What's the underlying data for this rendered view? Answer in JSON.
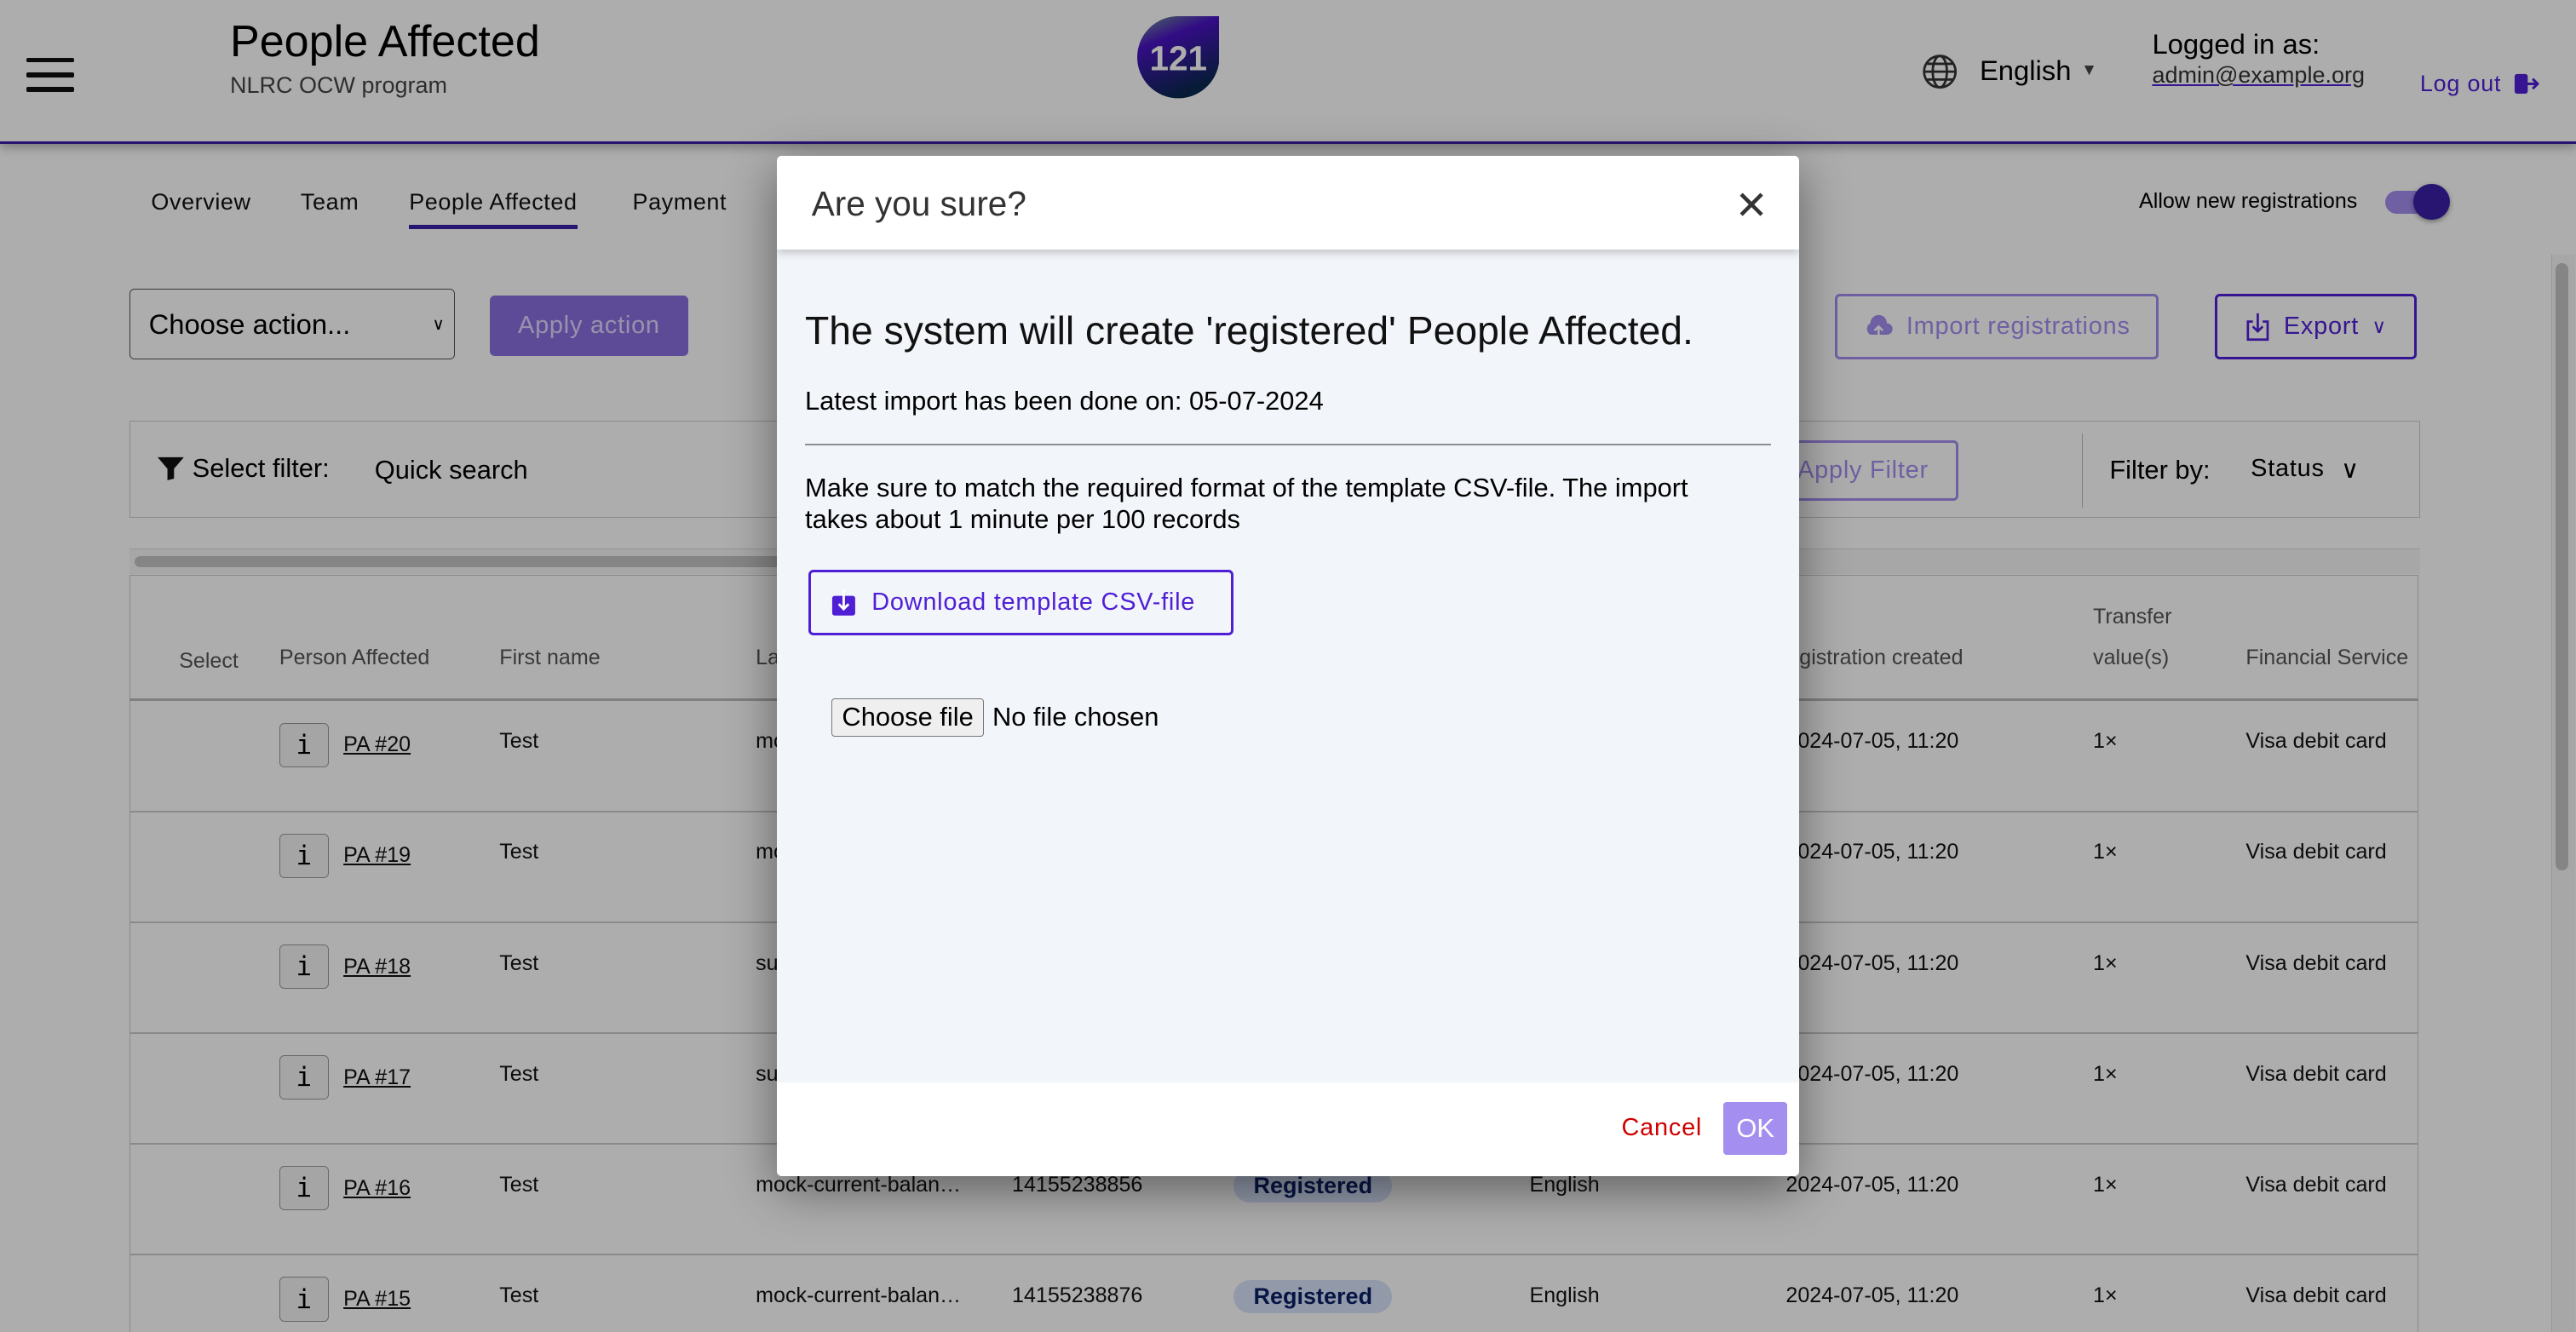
{
  "header": {
    "title": "People Affected",
    "subtitle": "NLRC OCW program",
    "logo_text": "121",
    "language": "English",
    "logged_in_label": "Logged in as:",
    "user_email": "admin@example.org",
    "logout_label": "Log out"
  },
  "tabs": [
    {
      "label": "Overview"
    },
    {
      "label": "Team"
    },
    {
      "label": "People Affected",
      "active": true
    },
    {
      "label": "Payment"
    }
  ],
  "allow_registrations": {
    "label": "Allow new registrations",
    "enabled": true
  },
  "actions": {
    "select_value": "Choose action...",
    "apply_label": "Apply action",
    "import_label": "Import registrations",
    "export_label": "Export"
  },
  "filter": {
    "select_label": "Select filter:",
    "quick_search": "Quick search",
    "apply_label": "Apply Filter",
    "filter_by_label": "Filter by:",
    "filter_by_value": "Status"
  },
  "table": {
    "headers": {
      "select": "Select",
      "person": "Person Affected",
      "first_name": "First name",
      "last_name_partial": "La",
      "registration_created_partial": "egistration created",
      "transfer_line1": "Transfer",
      "transfer_line2": "value(s)",
      "financial_service": "Financial Service"
    },
    "rows": [
      {
        "pa": "PA #20",
        "first": "Test",
        "last": "mo",
        "phone": "",
        "status": "",
        "lang": "",
        "created": "2024-07-05, 11:20",
        "transfer": "1×",
        "fsp": "Visa debit card"
      },
      {
        "pa": "PA #19",
        "first": "Test",
        "last": "mo",
        "phone": "",
        "status": "",
        "lang": "",
        "created": "2024-07-05, 11:20",
        "transfer": "1×",
        "fsp": "Visa debit card"
      },
      {
        "pa": "PA #18",
        "first": "Test",
        "last": "su",
        "phone": "",
        "status": "",
        "lang": "",
        "created": "2024-07-05, 11:20",
        "transfer": "1×",
        "fsp": "Visa debit card"
      },
      {
        "pa": "PA #17",
        "first": "Test",
        "last": "su",
        "phone": "",
        "status": "",
        "lang": "",
        "created": "2024-07-05, 11:20",
        "transfer": "1×",
        "fsp": "Visa debit card"
      },
      {
        "pa": "PA #16",
        "first": "Test",
        "last": "mock-current-balan…",
        "phone": "14155238856",
        "status": "Registered",
        "lang": "English",
        "created": "2024-07-05, 11:20",
        "transfer": "1×",
        "fsp": "Visa debit card"
      },
      {
        "pa": "PA #15",
        "first": "Test",
        "last": "mock-current-balan…",
        "phone": "14155238876",
        "status": "Registered",
        "lang": "English",
        "created": "2024-07-05, 11:20",
        "transfer": "1×",
        "fsp": "Visa debit card"
      }
    ],
    "info_label": "i"
  },
  "modal": {
    "title": "Are you sure?",
    "heading": "The system will create 'registered' People Affected.",
    "latest_import": "Latest import has been done on: 05-07-2024",
    "instructions": "Make sure to match the required format of the template CSV-file. The import takes about 1 minute per 100 records",
    "download_label": "Download template CSV-file",
    "choose_file_label": "Choose file",
    "no_file_label": "No file chosen",
    "cancel_label": "Cancel",
    "ok_label": "OK"
  },
  "colors": {
    "brand": "#4f1fd6",
    "cancel": "#d00000",
    "ok": "#a48ef0"
  }
}
